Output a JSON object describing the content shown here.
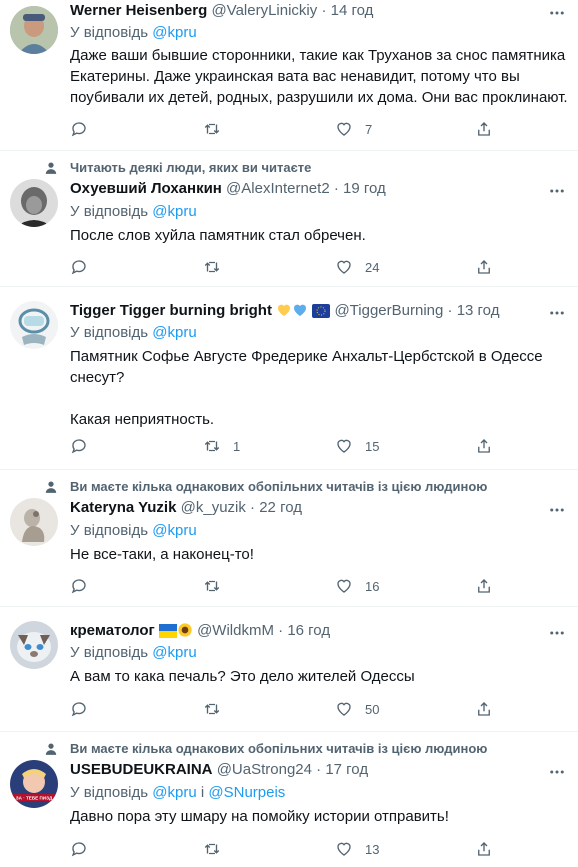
{
  "tweets": [
    {
      "social_context": "",
      "name": "Werner Heisenberg",
      "handle": "@ValeryLinickiy",
      "dot": "·",
      "time": "14 год",
      "reply_prefix": "У відповідь",
      "reply_to": "@kpru",
      "reply_joiner": "",
      "reply_to_2": "",
      "text": "Даже ваши бывшие сторонники, такие как Труханов за снос памятника Екатерины. Даже украинская вата вас ненавидит, потому что вы поубивали их детей, родных, разрушили их дома. Они вас проклинают.",
      "replies": "",
      "retweets": "",
      "likes": "7",
      "avatar_color": "#7a8a6a"
    },
    {
      "social_context": "Читають деякі люди, яких ви читаєте",
      "name": "Охуевший Лоханкин",
      "handle": "@AlexInternet2",
      "dot": "·",
      "time": "19 год",
      "reply_prefix": "У відповідь",
      "reply_to": "@kpru",
      "reply_joiner": "",
      "reply_to_2": "",
      "text": "После слов хуйла памятник стал обречен.",
      "replies": "",
      "retweets": "",
      "likes": "24",
      "avatar_color": "#5a5a5a"
    },
    {
      "social_context": "",
      "name": "Tigger Tigger burning bright",
      "handle": "@TiggerBurning",
      "dot": "·",
      "time": "13 год",
      "reply_prefix": "У відповідь",
      "reply_to": "@kpru",
      "reply_joiner": "",
      "reply_to_2": "",
      "text": "Памятник Софье Августе Фредерике Анхальт-Цербстской в Одессе снесут?\n\nКакая неприятность.",
      "replies": "",
      "retweets": "1",
      "likes": "15",
      "avatar_color": "#d8e4e8"
    },
    {
      "social_context": "Ви маєте кілька однакових обопільних читачів із цією людиною",
      "name": "Kateryna Yuzik",
      "handle": "@k_yuzik",
      "dot": "·",
      "time": "22 год",
      "reply_prefix": "У відповідь",
      "reply_to": "@kpru",
      "reply_joiner": "",
      "reply_to_2": "",
      "text": "Не все-таки, а наконец-то!",
      "replies": "",
      "retweets": "",
      "likes": "16",
      "avatar_color": "#c9c2b8"
    },
    {
      "social_context": "",
      "name": "крематолог",
      "handle": "@WildkmM",
      "dot": "·",
      "time": "16 год",
      "reply_prefix": "У відповідь",
      "reply_to": "@kpru",
      "reply_joiner": "",
      "reply_to_2": "",
      "text": "А вам то кака печаль? Это дело жителей Одессы",
      "replies": "",
      "retweets": "",
      "likes": "50",
      "avatar_color": "#8f99a3"
    },
    {
      "social_context": "Ви маєте кілька однакових обопільних читачів із цією людиною",
      "name": "USEBUDEUKRAINA",
      "handle": "@UaStrong24",
      "dot": "·",
      "time": "17 год",
      "reply_prefix": "У відповідь",
      "reply_to": "@kpru",
      "reply_joiner": "і",
      "reply_to_2": "@SNurpeis",
      "text": "Давно пора эту шмару на помойку истории отправить!",
      "replies": "",
      "retweets": "",
      "likes": "13",
      "avatar_color": "#7b1c2c"
    }
  ],
  "avatar_text_6": "ЗА · ТЕБЕ ПИЗД"
}
